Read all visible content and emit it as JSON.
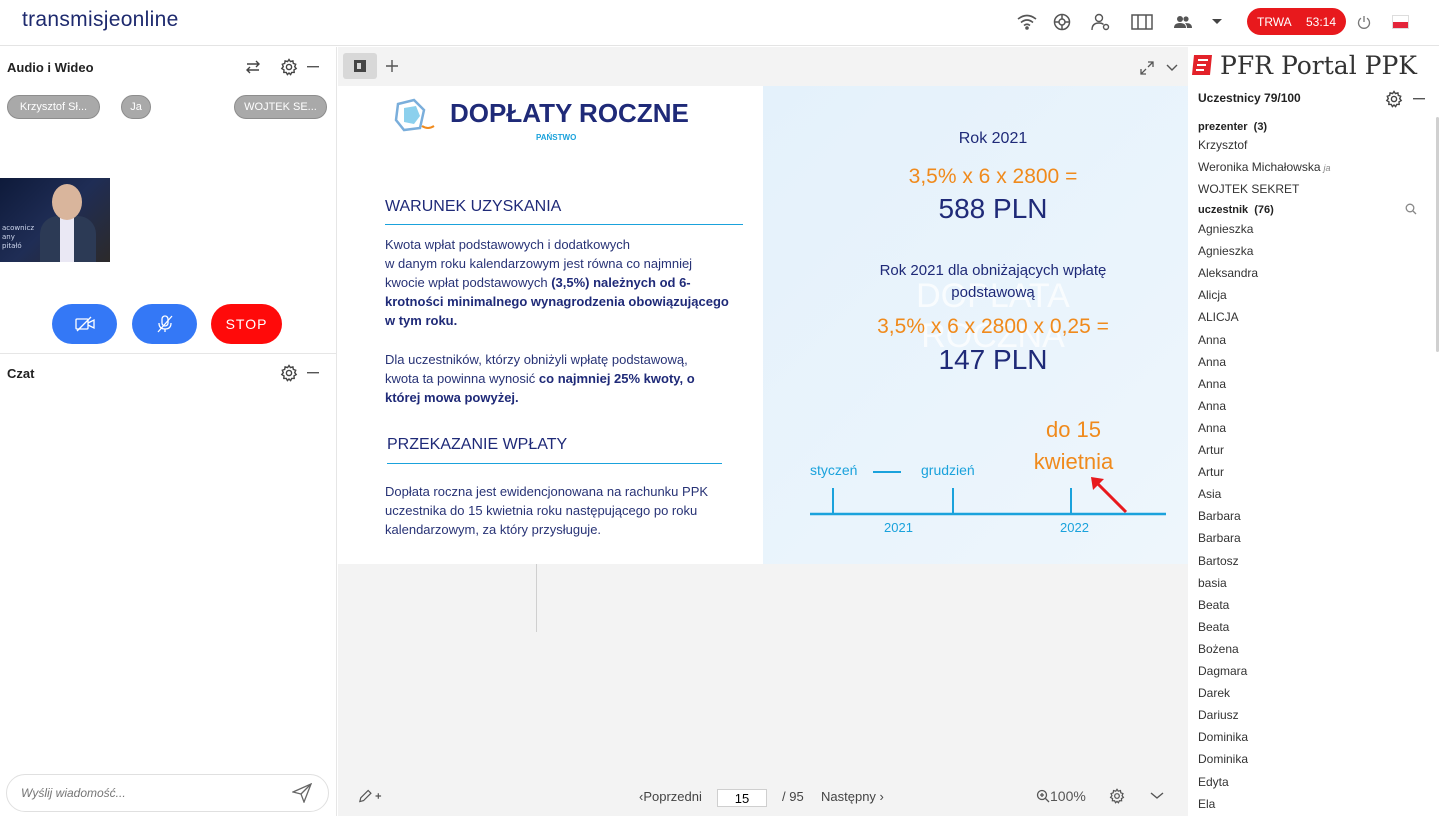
{
  "app": {
    "logo_part1": "transmisje",
    "logo_part2": "online",
    "status_label": "TRWA",
    "timer": "53:14"
  },
  "audio_video": {
    "title": "Audio i Wideo",
    "chips": [
      "Krzysztof Sł...",
      "Ja",
      "WOJTEK SE..."
    ],
    "video_caption": "acownicz\nany\npitałó",
    "stop_label": "STOP"
  },
  "chat": {
    "title": "Czat",
    "input_placeholder": "Wyślij wiadomość..."
  },
  "slide": {
    "title": "DOPŁATY ROCZNE",
    "subtitle": "PAŃSTWO",
    "h1": "WARUNEK UZYSKANIA",
    "p1_line1": "Kwota wpłat podstawowych i dodatkowych",
    "p1_line2": "w danym roku kalendarzowym jest równa co najmniej",
    "p1_line3a": "kwocie wpłat podstawowych ",
    "p1_line3b": "(3,5%) należnych od 6-",
    "p1_line4": "krotności minimalnego wynagrodzenia obowiązującego",
    "p1_line5": "w tym roku.",
    "p2_line1": "Dla uczestników, którzy obniżyli wpłatę podstawową,",
    "p2_line2a": "kwota ta powinna wynosić ",
    "p2_line2b": "co najmniej 25% kwoty, o",
    "p2_line3": "której mowa powyżej.",
    "h2": "PRZEKAZANIE WPŁATY",
    "p3_line1": "Dopłata roczna jest ewidencjonowana na rachunku PPK",
    "p3_line2": "uczestnika do 15 kwietnia roku następującego po roku",
    "p3_line3": "kalendarzowym, za który przysługuje.",
    "r_year1": "Rok 2021",
    "r_formula1": "3,5% x 6 x 2800 =",
    "r_result1": "588 PLN",
    "r_year2_line1": "Rok 2021 dla obniżających wpłatę",
    "r_year2_line2": "podstawową",
    "r_formula2": "3,5% x 6 x 2800 x 0,25 =",
    "r_result2": "147 PLN",
    "watermark_line1": "DOPŁATA",
    "watermark_line2": "ROCZNA",
    "deadline_line1": "do 15",
    "deadline_line2": "kwietnia",
    "tl_start": "styczeń",
    "tl_end": "grudzień",
    "tl_year1": "2021",
    "tl_year2": "2022"
  },
  "pager": {
    "prev_label": "‹Poprzedni",
    "current_page": "15",
    "total": "/ 95",
    "next_label": "Następny ›",
    "zoom": "100%"
  },
  "participants": {
    "brand": "PFR Portal PPK",
    "title": "Uczestnicy 79/100",
    "presenter_group": "prezenter",
    "presenter_count": "(3)",
    "presenters": [
      {
        "name": "Krzysztof",
        "tag": ""
      },
      {
        "name": "Weronika Michałowska",
        "tag": "ja"
      },
      {
        "name": "WOJTEK SEKRET",
        "tag": ""
      }
    ],
    "participant_group": "uczestnik",
    "participant_count": "(76)",
    "list": [
      "Agnieszka",
      "Agnieszka",
      "Aleksandra",
      "Alicja",
      "ALICJA",
      "Anna",
      "Anna",
      "Anna",
      "Anna",
      "Anna",
      "Artur",
      "Artur",
      "Asia",
      "Barbara",
      "Barbara",
      "Bartosz",
      "basia",
      "Beata",
      "Beata",
      "Bożena",
      "Dagmara",
      "Darek",
      "Dariusz",
      "Dominika",
      "Dominika",
      "Edyta",
      "Ela"
    ]
  },
  "colors": {
    "brand_navy": "#1e2a6e",
    "live_red": "#e8191d",
    "button_blue": "#3478f6",
    "stop_red": "#ff0a0a",
    "slide_orange": "#f08a1c",
    "slide_cyan": "#1aa2dc"
  }
}
